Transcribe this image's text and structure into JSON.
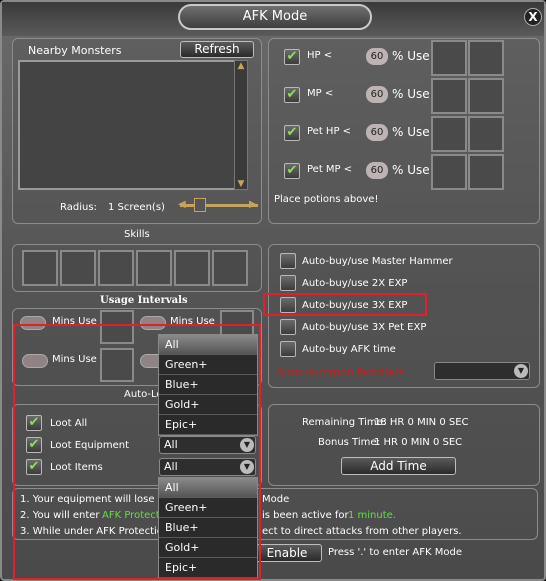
{
  "window": {
    "title": "AFK Mode",
    "close_label": "X"
  },
  "monsters": {
    "title": "Nearby Monsters",
    "refresh_label": "Refresh",
    "radius_label": "Radius:",
    "radius_value": "1 Screen(s)"
  },
  "potions": {
    "rows": [
      {
        "label": "HP <",
        "value": "60",
        "use": "% Use"
      },
      {
        "label": "MP <",
        "value": "60",
        "use": "% Use"
      },
      {
        "label": "Pet HP <",
        "value": "60",
        "use": "% Use"
      },
      {
        "label": "Pet MP <",
        "value": "60",
        "use": "% Use"
      }
    ],
    "note": "Place potions above!"
  },
  "skills": {
    "title": "Skills",
    "intervals_title": "Usage Intervals",
    "mins_use": "Mins Use"
  },
  "auto_buy": {
    "items": [
      "Auto-buy/use Master Hammer",
      "Auto-buy/use 2X EXP",
      "Auto-buy/use 3X EXP",
      "Auto-buy/use 3X Pet EXP",
      "Auto-buy AFK time"
    ],
    "summon_label": "Auto-summon familiars"
  },
  "loot": {
    "section_label": "Auto-Lo",
    "rows": [
      {
        "label": "Loot All"
      },
      {
        "label": "Loot Equipment",
        "dropdown": "All"
      },
      {
        "label": "Loot Items",
        "dropdown": "All"
      }
    ],
    "options": [
      "All",
      "Green+",
      "Blue+",
      "Gold+",
      "Epic+"
    ]
  },
  "time": {
    "remaining_label": "Remaining Time:",
    "remaining_value": "18 HR 0 MIN 0 SEC",
    "bonus_label": "Bonus Time:",
    "bonus_value": "1 HR 0 MIN 0 SEC",
    "add_label": "Add Time"
  },
  "info": {
    "line1a": "1. Your equipment will lose d",
    "line1b": "Mode",
    "line2a": "2. You will enter ",
    "line2_green": "AFK Protect",
    "line2b": "is been active for ",
    "line2_green2": "1 minute.",
    "line3a": "3. While under AFK Protectio",
    "line3b": "ect to direct attacks from other players."
  },
  "footer": {
    "enable_label": "Enable",
    "hint": "Press '.' to enter AFK Mode"
  },
  "colors": {
    "highlight": "#e0202a",
    "accent_green": "#5fe03a",
    "summon_red": "#c02020"
  }
}
